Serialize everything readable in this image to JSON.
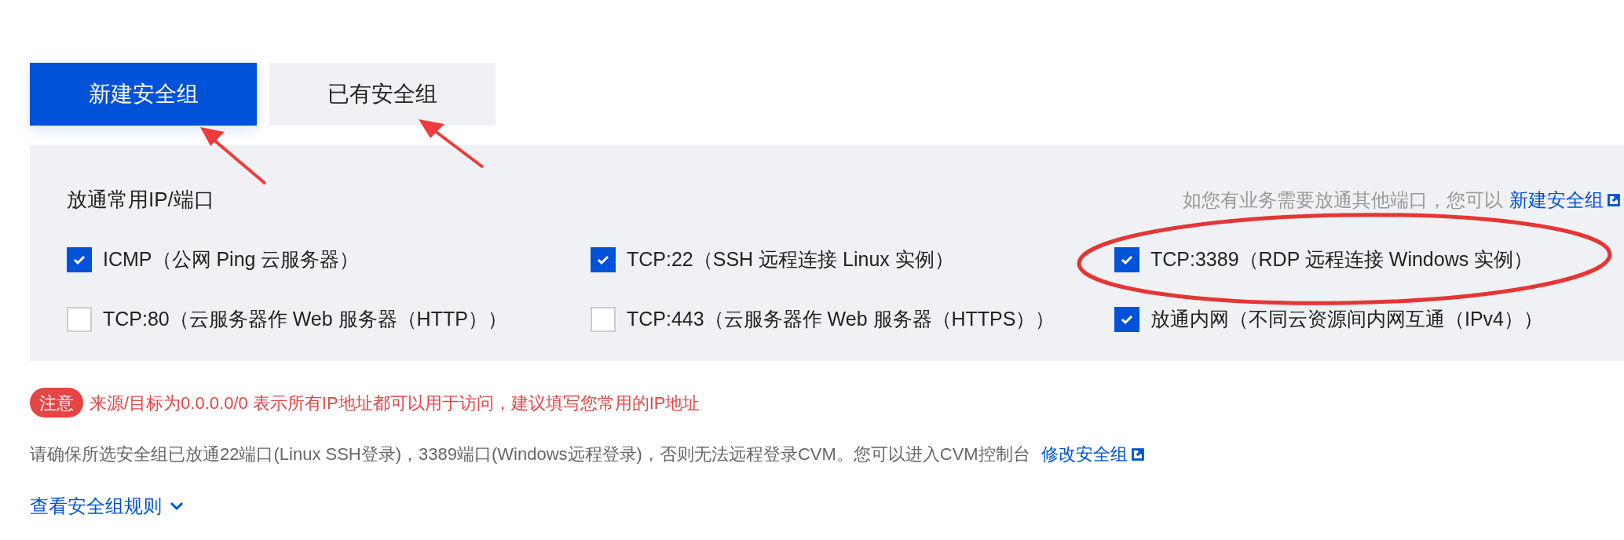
{
  "tabs": [
    {
      "label": "新建安全组",
      "selected": true
    },
    {
      "label": "已有安全组",
      "selected": false
    }
  ],
  "panel": {
    "title": "放通常用IP/端口",
    "hint": "如您有业务需要放通其他端口，您可以",
    "hint_link": "新建安全组",
    "options": [
      {
        "label": "ICMP（公网 Ping 云服务器）",
        "checked": true
      },
      {
        "label": "TCP:22（SSH 远程连接 Linux 实例）",
        "checked": true
      },
      {
        "label": "TCP:3389（RDP 远程连接 Windows 实例）",
        "checked": true
      },
      {
        "label": "TCP:80（云服务器作 Web 服务器（HTTP））",
        "checked": false
      },
      {
        "label": "TCP:443（云服务器作 Web 服务器（HTTPS））",
        "checked": false
      },
      {
        "label": "放通内网（不同云资源间内网互通（IPv4））",
        "checked": true
      }
    ]
  },
  "notice": {
    "badge": "注意",
    "text": "来源/目标为0.0.0.0/0 表示所有IP地址都可以用于访问，建议填写您常用的IP地址"
  },
  "info": {
    "text": "请确保所选安全组已放通22端口(Linux SSH登录)，3389端口(Windows远程登录)，否则无法远程登录CVM。您可以进入CVM控制台",
    "link": "修改安全组"
  },
  "rules_link": "查看安全组规则"
}
